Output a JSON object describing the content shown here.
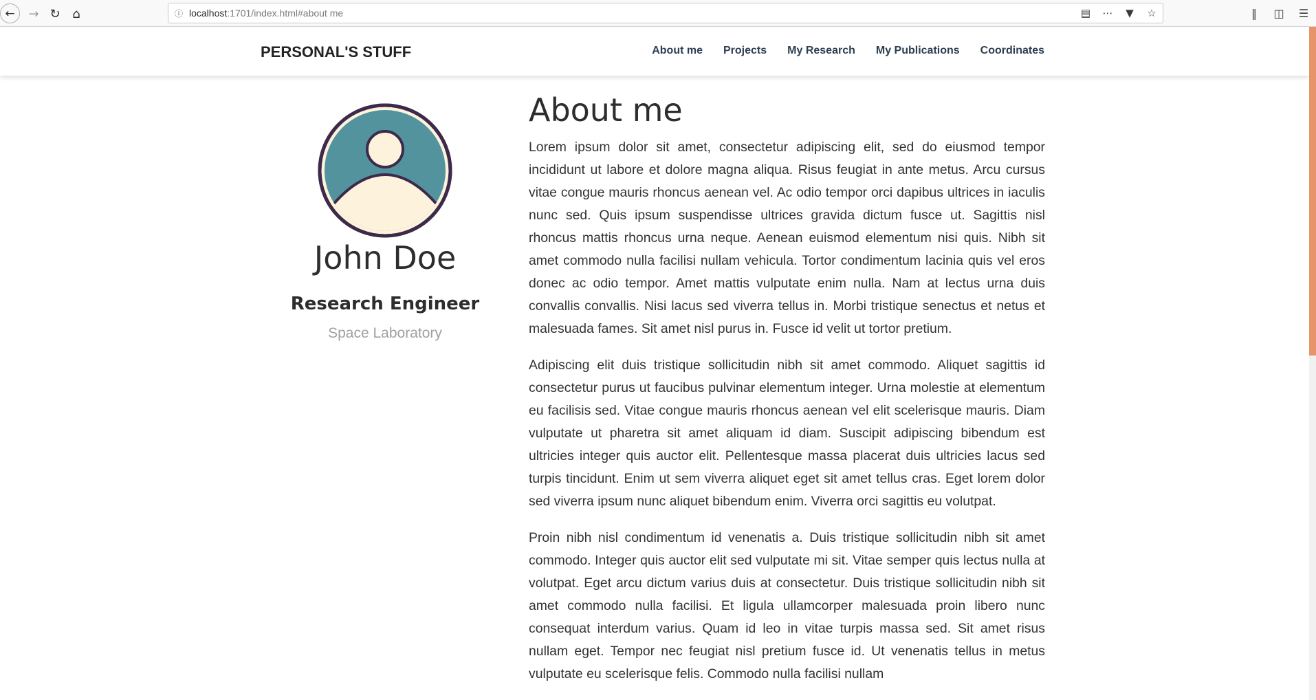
{
  "browser": {
    "url_host": "localhost",
    "url_rest": ":1701/index.html#about me",
    "back_icon": "back-arrow-icon",
    "forward_icon": "forward-arrow-icon",
    "reload_icon": "reload-icon",
    "home_icon": "home-icon"
  },
  "header": {
    "brand": "PERSONAL'S STUFF",
    "menu": [
      {
        "label": "About me"
      },
      {
        "label": "Projects"
      },
      {
        "label": "My Research"
      },
      {
        "label": "My Publications"
      },
      {
        "label": "Coordinates"
      }
    ]
  },
  "profile": {
    "name": "John Doe",
    "role": "Research Engineer",
    "affiliation": "Space Laboratory",
    "avatar_colors": {
      "ring": "#3d2a4a",
      "background": "#52939e",
      "figure": "#fdf3dd"
    }
  },
  "main": {
    "title": "About me",
    "paragraphs": [
      "Lorem ipsum dolor sit amet, consectetur adipiscing elit, sed do eiusmod tempor incididunt ut labore et dolore magna aliqua. Risus feugiat in ante metus. Arcu cursus vitae congue mauris rhoncus aenean vel. Ac odio tempor orci dapibus ultrices in iaculis nunc sed. Quis ipsum suspendisse ultrices gravida dictum fusce ut. Sagittis nisl rhoncus mattis rhoncus urna neque. Aenean euismod elementum nisi quis. Nibh sit amet commodo nulla facilisi nullam vehicula. Tortor condimentum lacinia quis vel eros donec ac odio tempor. Amet mattis vulputate enim nulla. Nam at lectus urna duis convallis convallis. Nisi lacus sed viverra tellus in. Morbi tristique senectus et netus et malesuada fames. Sit amet nisl purus in. Fusce id velit ut tortor pretium.",
      "Adipiscing elit duis tristique sollicitudin nibh sit amet commodo. Aliquet sagittis id consectetur purus ut faucibus pulvinar elementum integer. Urna molestie at elementum eu facilisis sed. Vitae congue mauris rhoncus aenean vel elit scelerisque mauris. Diam vulputate ut pharetra sit amet aliquam id diam. Suscipit adipiscing bibendum est ultricies integer quis auctor elit. Pellentesque massa placerat duis ultricies lacus sed turpis tincidunt. Enim ut sem viverra aliquet eget sit amet tellus cras. Eget lorem dolor sed viverra ipsum nunc aliquet bibendum enim. Viverra orci sagittis eu volutpat.",
      "Proin nibh nisl condimentum id venenatis a. Duis tristique sollicitudin nibh sit amet commodo. Integer quis auctor elit sed vulputate mi sit. Vitae semper quis lectus nulla at volutpat. Eget arcu dictum varius duis at consectetur. Duis tristique sollicitudin nibh sit amet commodo nulla facilisi. Et ligula ullamcorper malesuada proin libero nunc consequat interdum varius. Quam id leo in vitae turpis massa sed. Sit amet risus nullam eget. Tempor nec feugiat nisl pretium fusce id. Ut venenatis tellus in metus vulputate eu scelerisque felis. Commodo nulla facilisi nullam"
    ]
  }
}
